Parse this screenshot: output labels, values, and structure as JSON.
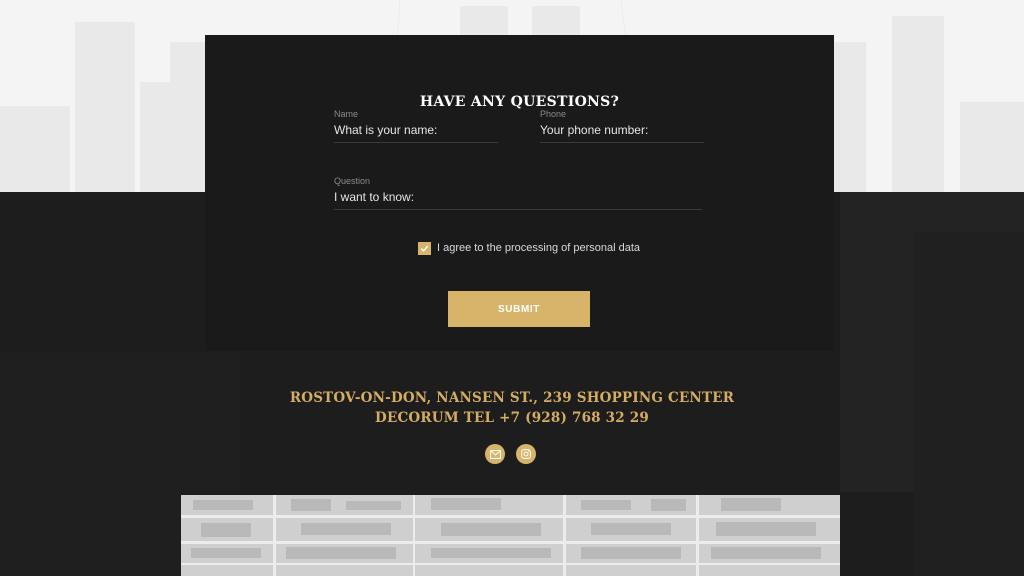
{
  "form": {
    "title": "HAVE ANY QUESTIONS?",
    "name_label": "Name",
    "name_placeholder": "What is your name:",
    "phone_label": "Phone",
    "phone_placeholder": "Your phone number:",
    "question_label": "Question",
    "question_placeholder": "I want to know:",
    "agree_text": "I agree to the processing of personal data",
    "agree_checked": true,
    "submit_label": "SUBMIT"
  },
  "contacts": {
    "address_line1": "ROSTOV-ON-DON, NANSEN ST., 239 SHOPPING CENTER",
    "address_line2": "DECORUM TEL +7 (928) 768 32 29",
    "social": [
      {
        "icon": "mail-icon"
      },
      {
        "icon": "instagram-icon"
      }
    ]
  },
  "colors": {
    "accent": "#d8b46a",
    "card": "#1a1a1a",
    "background_dark": "#1d1d1d",
    "background_light": "#f4f4f4"
  }
}
